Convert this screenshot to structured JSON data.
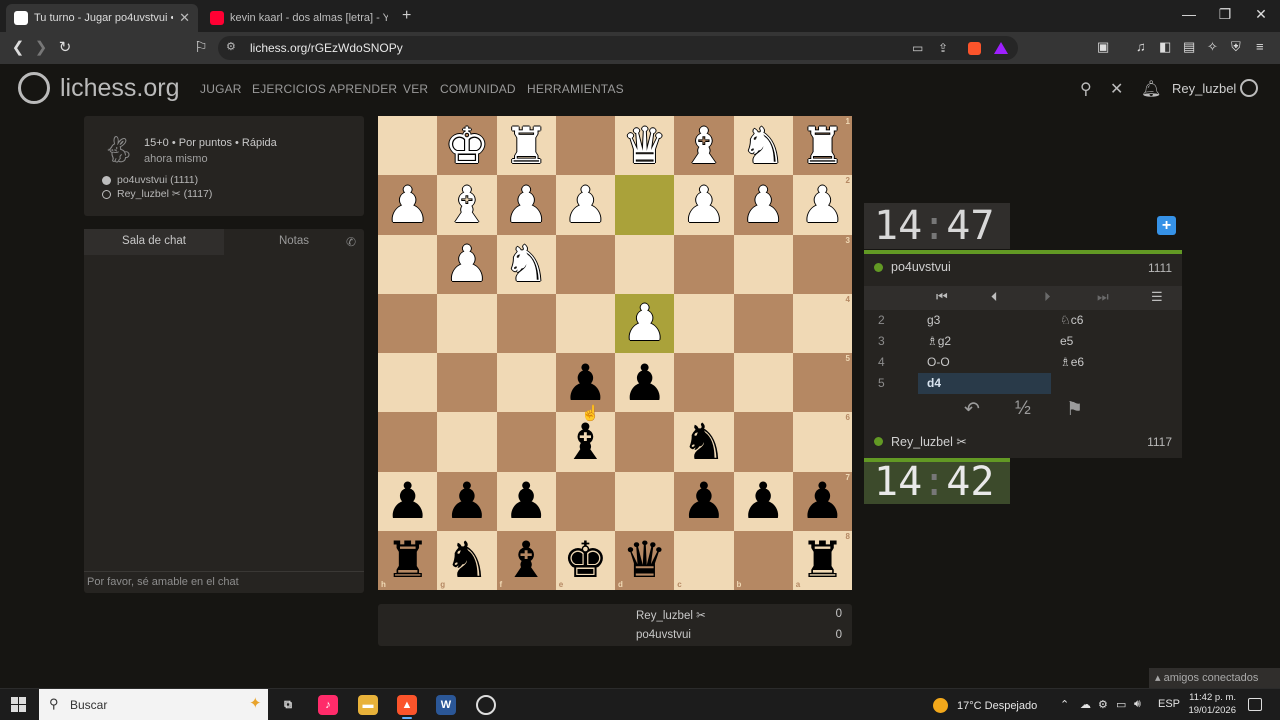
{
  "browser": {
    "tabs": [
      {
        "title": "Tu turno - Jugar po4uvstvui • lic",
        "active": true,
        "favicon_color": "#ffffff"
      },
      {
        "title": "kevin kaarl - dos almas [letra] - Yo",
        "active": false,
        "favicon_color": "#ff0033"
      }
    ],
    "url": "lichess.org/rGEzWdoSNOPy"
  },
  "site": {
    "logo": "lichess.org",
    "nav": [
      "JUGAR",
      "EJERCICIOS",
      "APRENDER",
      "VER",
      "COMUNIDAD",
      "HERRAMIENTAS"
    ],
    "username": "Rey_luzbel"
  },
  "game_info": {
    "setup": "15+0 • Por puntos • Rápida",
    "time_ago": "ahora mismo",
    "players": [
      {
        "label": "po4uvstvui (1111)",
        "color": "white"
      },
      {
        "label": "Rey_luzbel ✂ (1117)",
        "color": "black"
      }
    ]
  },
  "chat": {
    "tabs": [
      "Sala de chat",
      "Notas"
    ],
    "placeholder": "Por favor, sé amable en el chat"
  },
  "board": {
    "orientation": "black",
    "rank_labels": [
      "1",
      "2",
      "3",
      "4",
      "5",
      "6",
      "7",
      "8"
    ],
    "file_labels": [
      "h",
      "g",
      "f",
      "e",
      "d",
      "c",
      "b",
      "a"
    ],
    "highlight": [
      [
        1,
        4
      ],
      [
        3,
        4
      ]
    ],
    "rows": [
      [
        "",
        "wK",
        "wR",
        "",
        "wQ",
        "wB",
        "wN",
        "wR"
      ],
      [
        "wP",
        "wB",
        "wP",
        "wP",
        "",
        "wP",
        "wP",
        "wP"
      ],
      [
        "",
        "wP",
        "wN",
        "",
        "",
        "",
        "",
        ""
      ],
      [
        "",
        "",
        "",
        "",
        "wP",
        "",
        "",
        ""
      ],
      [
        "",
        "",
        "",
        "bP",
        "bP",
        "",
        "",
        ""
      ],
      [
        "",
        "",
        "",
        "bB",
        "",
        "bN",
        "",
        ""
      ],
      [
        "bP",
        "bP",
        "bP",
        "",
        "",
        "bP",
        "bP",
        "bP"
      ],
      [
        "bR",
        "bN",
        "bB",
        "bK",
        "bQ",
        "",
        "",
        "bR"
      ]
    ]
  },
  "clocks": {
    "top": {
      "min": "14",
      "sec": "47"
    },
    "bottom": {
      "min": "14",
      "sec": "42"
    }
  },
  "moves_panel": {
    "top_player": {
      "name": "po4uvstvui",
      "rating": "1111"
    },
    "bottom_player": {
      "name": "Rey_luzbel ✂",
      "rating": "1117"
    },
    "moves": [
      {
        "num": "2",
        "white": "g3",
        "black": "♘c6"
      },
      {
        "num": "3",
        "white": "♗g2",
        "black": "e5"
      },
      {
        "num": "4",
        "white": "O-O",
        "black": "♗e6"
      },
      {
        "num": "5",
        "white": "d4",
        "black": ""
      }
    ],
    "controls": {
      "takeback": "↶",
      "draw": "½",
      "resign": "⚑"
    }
  },
  "scores": [
    {
      "name": "Rey_luzbel ✂",
      "value": "0"
    },
    {
      "name": "po4uvstvui",
      "value": "0"
    }
  ],
  "friends": "▴ amigos conectados",
  "taskbar": {
    "search": "Buscar",
    "weather": "17°C  Despejado",
    "lang": "ESP",
    "time": "11:42 p. m.",
    "date": "19/01/2026"
  },
  "colors": {
    "board_light": "#f0d9b5",
    "board_dark": "#b58863",
    "accent_green": "#629924",
    "move_highlight": "#293a49"
  }
}
